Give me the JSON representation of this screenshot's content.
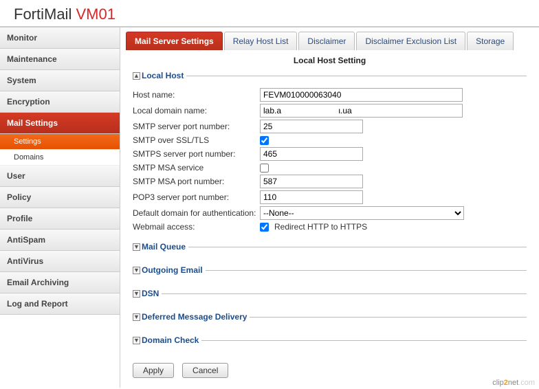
{
  "brand": {
    "part1": "FortiMail ",
    "part2": "VM01"
  },
  "sidebar": {
    "items": [
      {
        "label": "Monitor"
      },
      {
        "label": "Maintenance"
      },
      {
        "label": "System"
      },
      {
        "label": "Encryption"
      },
      {
        "label": "Mail Settings",
        "active": true,
        "children": [
          {
            "label": "Settings",
            "active": true
          },
          {
            "label": "Domains"
          }
        ]
      },
      {
        "label": "User"
      },
      {
        "label": "Policy"
      },
      {
        "label": "Profile"
      },
      {
        "label": "AntiSpam"
      },
      {
        "label": "AntiVirus"
      },
      {
        "label": "Email Archiving"
      },
      {
        "label": "Log and Report"
      }
    ]
  },
  "tabs": [
    {
      "label": "Mail Server Settings",
      "active": true
    },
    {
      "label": "Relay Host List"
    },
    {
      "label": "Disclaimer"
    },
    {
      "label": "Disclaimer Exclusion List"
    },
    {
      "label": "Storage"
    }
  ],
  "sectionTitle": "Local Host Setting",
  "panels": {
    "localHost": {
      "legend": "Local Host",
      "toggle": "▲",
      "rows": {
        "hostName": {
          "label": "Host name:",
          "value": "FEVM010000063040"
        },
        "localDomain": {
          "label": "Local domain name:",
          "value": "lab.a                         ι.ua"
        },
        "smtpPort": {
          "label": "SMTP server port number:",
          "value": "25"
        },
        "smtpSsl": {
          "label": "SMTP over SSL/TLS",
          "checked": true
        },
        "smtpsPort": {
          "label": "SMTPS server port number:",
          "value": "465"
        },
        "msaService": {
          "label": "SMTP MSA service",
          "checked": false
        },
        "msaPort": {
          "label": "SMTP MSA port number:",
          "value": "587"
        },
        "pop3Port": {
          "label": "POP3 server port number:",
          "value": "110"
        },
        "defaultDomain": {
          "label": "Default domain for authentication:",
          "value": "--None--"
        },
        "webmail": {
          "label": "Webmail access:",
          "checked": true,
          "text": "Redirect HTTP to HTTPS"
        }
      }
    },
    "mailQueue": {
      "legend": "Mail Queue",
      "toggle": "▼"
    },
    "outgoing": {
      "legend": "Outgoing Email",
      "toggle": "▼"
    },
    "dsn": {
      "legend": "DSN",
      "toggle": "▼"
    },
    "deferred": {
      "legend": "Deferred Message Delivery",
      "toggle": "▼"
    },
    "domainCheck": {
      "legend": "Domain Check",
      "toggle": "▼"
    }
  },
  "buttons": {
    "apply": "Apply",
    "cancel": "Cancel"
  },
  "watermark": {
    "a": "clip",
    "b": "2",
    "c": "net",
    "d": ".com"
  }
}
